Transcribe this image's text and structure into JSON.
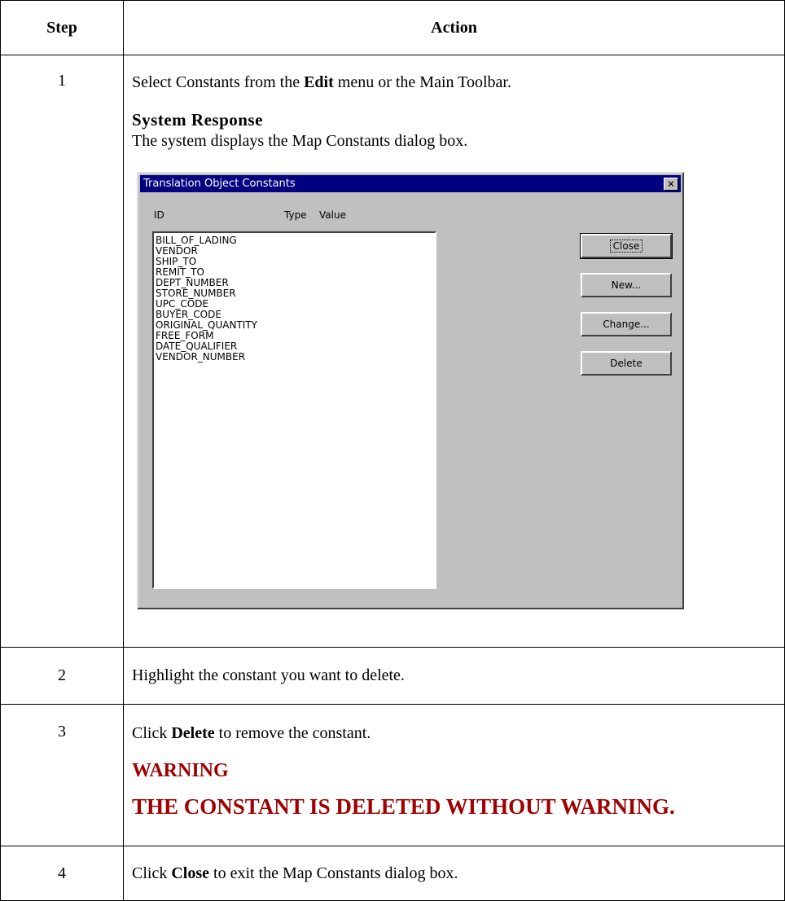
{
  "table": {
    "headers": {
      "step": "Step",
      "action": "Action"
    },
    "rows": [
      {
        "step": "1",
        "pre": "Select Constants from the ",
        "bold": "Edit",
        "post": " menu or the Main Toolbar.",
        "response_title": "System Response",
        "response_text": "The system displays the Map Constants dialog box."
      },
      {
        "step": "2",
        "text": "Highlight the constant you want to delete."
      },
      {
        "step": "3",
        "pre": "Click ",
        "bold": "Delete",
        "post": " to remove the constant.",
        "warning_title": "WARNING",
        "warning_text": "THE CONSTANT IS DELETED WITHOUT WARNING."
      },
      {
        "step": "4",
        "pre": "Click ",
        "bold": "Close",
        "post": " to exit the Map Constants dialog box."
      }
    ]
  },
  "dialog": {
    "title": "Translation Object Constants",
    "close_glyph": "✕",
    "columns": {
      "id": "ID",
      "type": "Type",
      "value": "Value"
    },
    "items": [
      "BILL_OF_LADING",
      "VENDOR",
      "SHIP_TO",
      "REMIT_TO",
      "DEPT_NUMBER",
      "STORE_NUMBER",
      "UPC_CODE",
      "BUYER_CODE",
      "ORIGINAL_QUANTITY",
      "FREE_FORM",
      "DATE_QUALIFIER",
      "VENDOR_NUMBER"
    ],
    "buttons": {
      "close": "Close",
      "new": "New...",
      "change": "Change...",
      "delete": "Delete"
    }
  },
  "colors": {
    "warning": "#a00000",
    "titlebar": "#000080",
    "dialog_face": "#c0c0c0"
  }
}
